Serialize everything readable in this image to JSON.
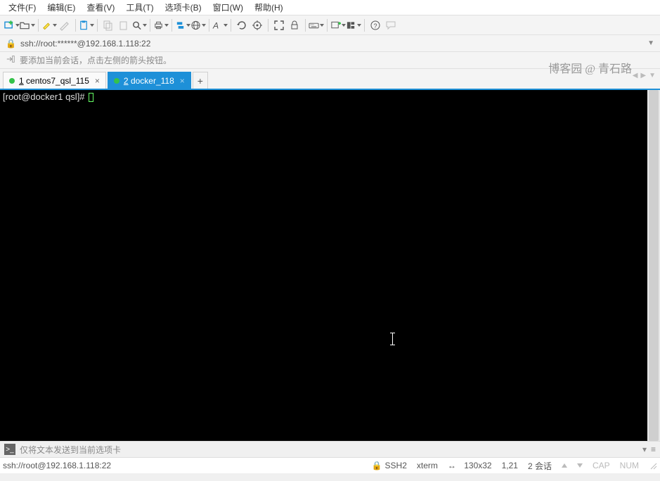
{
  "menu": {
    "file": "文件(F)",
    "edit": "编辑(E)",
    "view": "查看(V)",
    "tools": "工具(T)",
    "tabs": "选项卡(B)",
    "window": "窗口(W)",
    "help": "帮助(H)"
  },
  "address": {
    "url": "ssh://root:******@192.168.1.118:22"
  },
  "infobar": {
    "text": "要添加当前会话，点击左侧的箭头按钮。"
  },
  "watermark": "博客园 @ 青石路",
  "tablist": {
    "tabs": [
      {
        "num": "1",
        "label": "centos7_qsl_115",
        "active": false
      },
      {
        "num": "2",
        "label": "docker_118",
        "active": true
      }
    ],
    "add": "+"
  },
  "terminal": {
    "prompt": "[root@docker1 qsl]# "
  },
  "sendbar": {
    "placeholder": "仅将文本发送到当前选项卡"
  },
  "status": {
    "connection": "ssh://root@192.168.1.118:22",
    "protocol": "SSH2",
    "term": "xterm",
    "size": "130x32",
    "pos": "1,21",
    "sessions": "2 会话",
    "cap": "CAP",
    "num": "NUM"
  },
  "icons": {
    "lock": "🔒",
    "size_glyph": "↔",
    "hamburger": "≡",
    "help": "?",
    "chat": "💬"
  }
}
